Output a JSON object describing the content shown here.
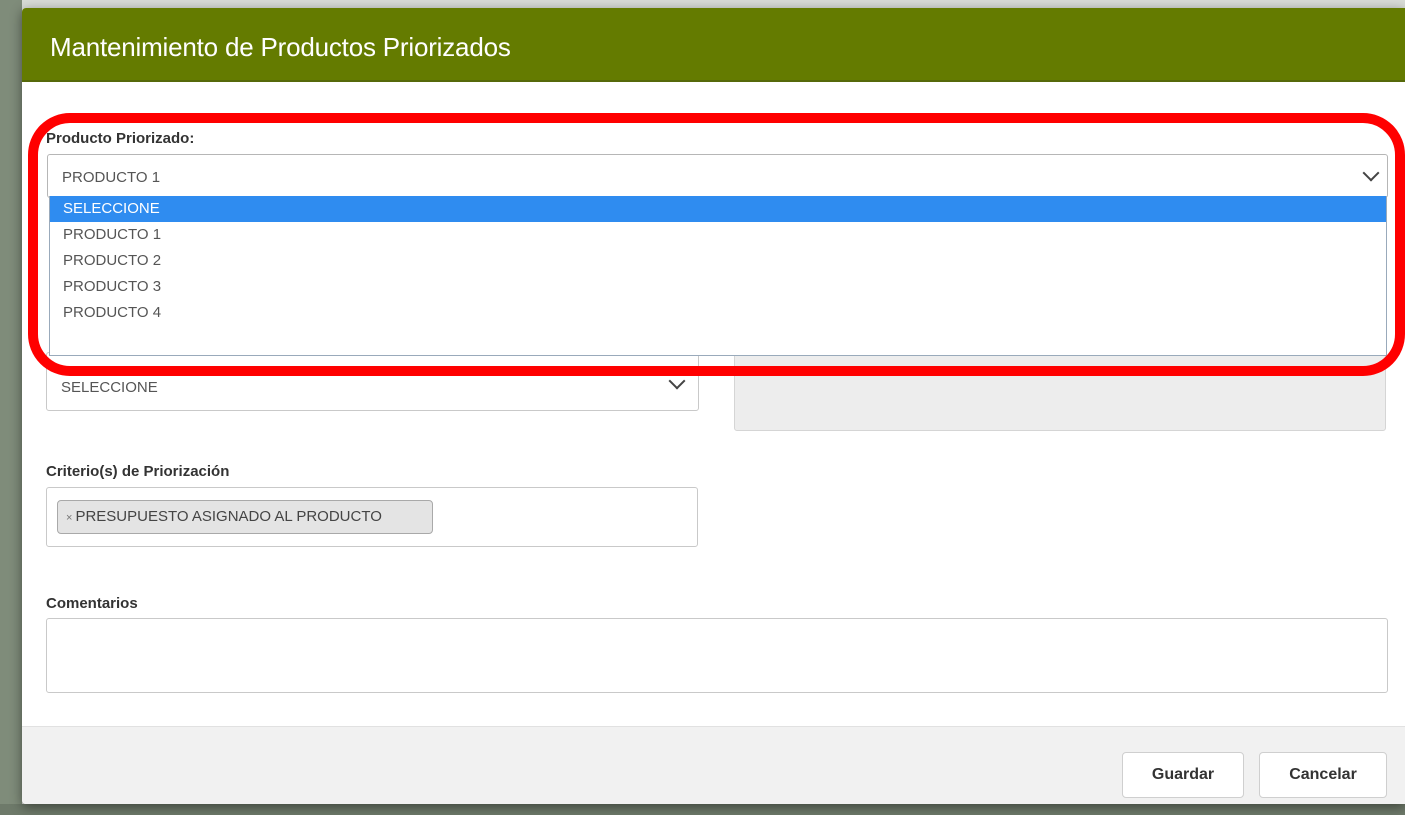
{
  "modal": {
    "title": "Mantenimiento de Productos Priorizados"
  },
  "producto": {
    "label": "Producto Priorizado:",
    "selected": "PRODUCTO 1",
    "options": [
      "SELECCIONE",
      "PRODUCTO 1",
      "PRODUCTO 2",
      "PRODUCTO 3",
      "PRODUCTO 4"
    ],
    "highlighted_option": "SELECCIONE"
  },
  "second_select": {
    "value": "SELECCIONE"
  },
  "criterios": {
    "label": "Criterio(s) de Priorización",
    "tag_remove_glyph": "×",
    "tags": [
      "PRESUPUESTO ASIGNADO AL PRODUCTO"
    ]
  },
  "comentarios": {
    "label": "Comentarios",
    "value": ""
  },
  "footer": {
    "save_label": "Guardar",
    "cancel_label": "Cancelar"
  },
  "colors": {
    "header_bg": "#647b00",
    "option_highlight": "#2f8cf0",
    "annotation_ring": "#ff0000"
  }
}
